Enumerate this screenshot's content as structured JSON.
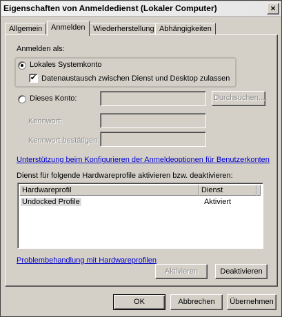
{
  "window": {
    "title": "Eigenschaften von Anmeldedienst (Lokaler Computer)",
    "close_glyph": "×"
  },
  "tabs": [
    "Allgemein",
    "Anmelden",
    "Wiederherstellung",
    "Abhängigkeiten"
  ],
  "active_tab": "Anmelden",
  "logon": {
    "logon_as_label": "Anmelden als:",
    "local_system_label": "Lokales Systemkonto",
    "local_system_selected": true,
    "desktop_interact_label": "Datenaustausch zwischen Dienst und Desktop zulassen",
    "desktop_interact_checked": true,
    "check_glyph": "✔",
    "this_account_label": "Dieses Konto:",
    "this_account_value": "",
    "browse_button": "Durchsuchen...",
    "password_label": "Kennwort:",
    "confirm_password_label": "Kennwort bestätigen:"
  },
  "help_link": "Unterstützung beim Konfigurieren der Anmeldeoptionen für Benutzerkonten",
  "profiles": {
    "description": "Dienst für folgende Hardwareprofile aktivieren bzw. deaktivieren:",
    "columns": [
      "Hardwareprofil",
      "Dienst"
    ],
    "rows": [
      {
        "profile": "Undocked Profile",
        "service": "Aktiviert"
      }
    ]
  },
  "troubleshoot_link": "Problembehandlung mit Hardwareprofilen",
  "buttons": {
    "activate": "Aktivieren",
    "deactivate": "Deaktivieren",
    "ok": "OK",
    "cancel": "Abbrechen",
    "apply": "Übernehmen"
  }
}
